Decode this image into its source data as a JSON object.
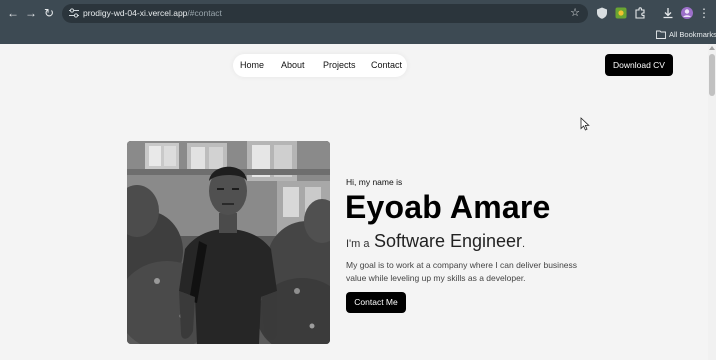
{
  "browser": {
    "url_host": "prodigy-wd-04-xi.vercel.app",
    "url_path": "/#contact",
    "bookmarks_label": "All Bookmarks"
  },
  "nav": {
    "items": [
      {
        "label": "Home"
      },
      {
        "label": "About"
      },
      {
        "label": "Projects"
      },
      {
        "label": "Contact"
      }
    ],
    "cv_button": "Download CV"
  },
  "hero": {
    "greeting": "Hi, my name is",
    "name": "Eyoab Amare",
    "role_prefix": "I'm a",
    "role": "Software Engineer",
    "role_suffix": ".",
    "description": "My goal is to work at a company where I can deliver business value while leveling up my skills as a developer.",
    "contact_button": "Contact Me"
  },
  "colors": {
    "chrome": "#3d4a53",
    "page_bg": "#f4f4f4",
    "button_bg": "#000000"
  }
}
